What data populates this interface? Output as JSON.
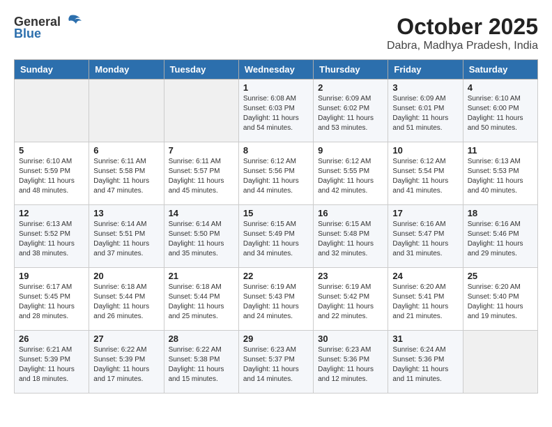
{
  "header": {
    "logo_general": "General",
    "logo_blue": "Blue",
    "title": "October 2025",
    "subtitle": "Dabra, Madhya Pradesh, India"
  },
  "weekdays": [
    "Sunday",
    "Monday",
    "Tuesday",
    "Wednesday",
    "Thursday",
    "Friday",
    "Saturday"
  ],
  "weeks": [
    [
      {
        "day": "",
        "info": ""
      },
      {
        "day": "",
        "info": ""
      },
      {
        "day": "",
        "info": ""
      },
      {
        "day": "1",
        "info": "Sunrise: 6:08 AM\nSunset: 6:03 PM\nDaylight: 11 hours\nand 54 minutes."
      },
      {
        "day": "2",
        "info": "Sunrise: 6:09 AM\nSunset: 6:02 PM\nDaylight: 11 hours\nand 53 minutes."
      },
      {
        "day": "3",
        "info": "Sunrise: 6:09 AM\nSunset: 6:01 PM\nDaylight: 11 hours\nand 51 minutes."
      },
      {
        "day": "4",
        "info": "Sunrise: 6:10 AM\nSunset: 6:00 PM\nDaylight: 11 hours\nand 50 minutes."
      }
    ],
    [
      {
        "day": "5",
        "info": "Sunrise: 6:10 AM\nSunset: 5:59 PM\nDaylight: 11 hours\nand 48 minutes."
      },
      {
        "day": "6",
        "info": "Sunrise: 6:11 AM\nSunset: 5:58 PM\nDaylight: 11 hours\nand 47 minutes."
      },
      {
        "day": "7",
        "info": "Sunrise: 6:11 AM\nSunset: 5:57 PM\nDaylight: 11 hours\nand 45 minutes."
      },
      {
        "day": "8",
        "info": "Sunrise: 6:12 AM\nSunset: 5:56 PM\nDaylight: 11 hours\nand 44 minutes."
      },
      {
        "day": "9",
        "info": "Sunrise: 6:12 AM\nSunset: 5:55 PM\nDaylight: 11 hours\nand 42 minutes."
      },
      {
        "day": "10",
        "info": "Sunrise: 6:12 AM\nSunset: 5:54 PM\nDaylight: 11 hours\nand 41 minutes."
      },
      {
        "day": "11",
        "info": "Sunrise: 6:13 AM\nSunset: 5:53 PM\nDaylight: 11 hours\nand 40 minutes."
      }
    ],
    [
      {
        "day": "12",
        "info": "Sunrise: 6:13 AM\nSunset: 5:52 PM\nDaylight: 11 hours\nand 38 minutes."
      },
      {
        "day": "13",
        "info": "Sunrise: 6:14 AM\nSunset: 5:51 PM\nDaylight: 11 hours\nand 37 minutes."
      },
      {
        "day": "14",
        "info": "Sunrise: 6:14 AM\nSunset: 5:50 PM\nDaylight: 11 hours\nand 35 minutes."
      },
      {
        "day": "15",
        "info": "Sunrise: 6:15 AM\nSunset: 5:49 PM\nDaylight: 11 hours\nand 34 minutes."
      },
      {
        "day": "16",
        "info": "Sunrise: 6:15 AM\nSunset: 5:48 PM\nDaylight: 11 hours\nand 32 minutes."
      },
      {
        "day": "17",
        "info": "Sunrise: 6:16 AM\nSunset: 5:47 PM\nDaylight: 11 hours\nand 31 minutes."
      },
      {
        "day": "18",
        "info": "Sunrise: 6:16 AM\nSunset: 5:46 PM\nDaylight: 11 hours\nand 29 minutes."
      }
    ],
    [
      {
        "day": "19",
        "info": "Sunrise: 6:17 AM\nSunset: 5:45 PM\nDaylight: 11 hours\nand 28 minutes."
      },
      {
        "day": "20",
        "info": "Sunrise: 6:18 AM\nSunset: 5:44 PM\nDaylight: 11 hours\nand 26 minutes."
      },
      {
        "day": "21",
        "info": "Sunrise: 6:18 AM\nSunset: 5:44 PM\nDaylight: 11 hours\nand 25 minutes."
      },
      {
        "day": "22",
        "info": "Sunrise: 6:19 AM\nSunset: 5:43 PM\nDaylight: 11 hours\nand 24 minutes."
      },
      {
        "day": "23",
        "info": "Sunrise: 6:19 AM\nSunset: 5:42 PM\nDaylight: 11 hours\nand 22 minutes."
      },
      {
        "day": "24",
        "info": "Sunrise: 6:20 AM\nSunset: 5:41 PM\nDaylight: 11 hours\nand 21 minutes."
      },
      {
        "day": "25",
        "info": "Sunrise: 6:20 AM\nSunset: 5:40 PM\nDaylight: 11 hours\nand 19 minutes."
      }
    ],
    [
      {
        "day": "26",
        "info": "Sunrise: 6:21 AM\nSunset: 5:39 PM\nDaylight: 11 hours\nand 18 minutes."
      },
      {
        "day": "27",
        "info": "Sunrise: 6:22 AM\nSunset: 5:39 PM\nDaylight: 11 hours\nand 17 minutes."
      },
      {
        "day": "28",
        "info": "Sunrise: 6:22 AM\nSunset: 5:38 PM\nDaylight: 11 hours\nand 15 minutes."
      },
      {
        "day": "29",
        "info": "Sunrise: 6:23 AM\nSunset: 5:37 PM\nDaylight: 11 hours\nand 14 minutes."
      },
      {
        "day": "30",
        "info": "Sunrise: 6:23 AM\nSunset: 5:36 PM\nDaylight: 11 hours\nand 12 minutes."
      },
      {
        "day": "31",
        "info": "Sunrise: 6:24 AM\nSunset: 5:36 PM\nDaylight: 11 hours\nand 11 minutes."
      },
      {
        "day": "",
        "info": ""
      }
    ]
  ]
}
